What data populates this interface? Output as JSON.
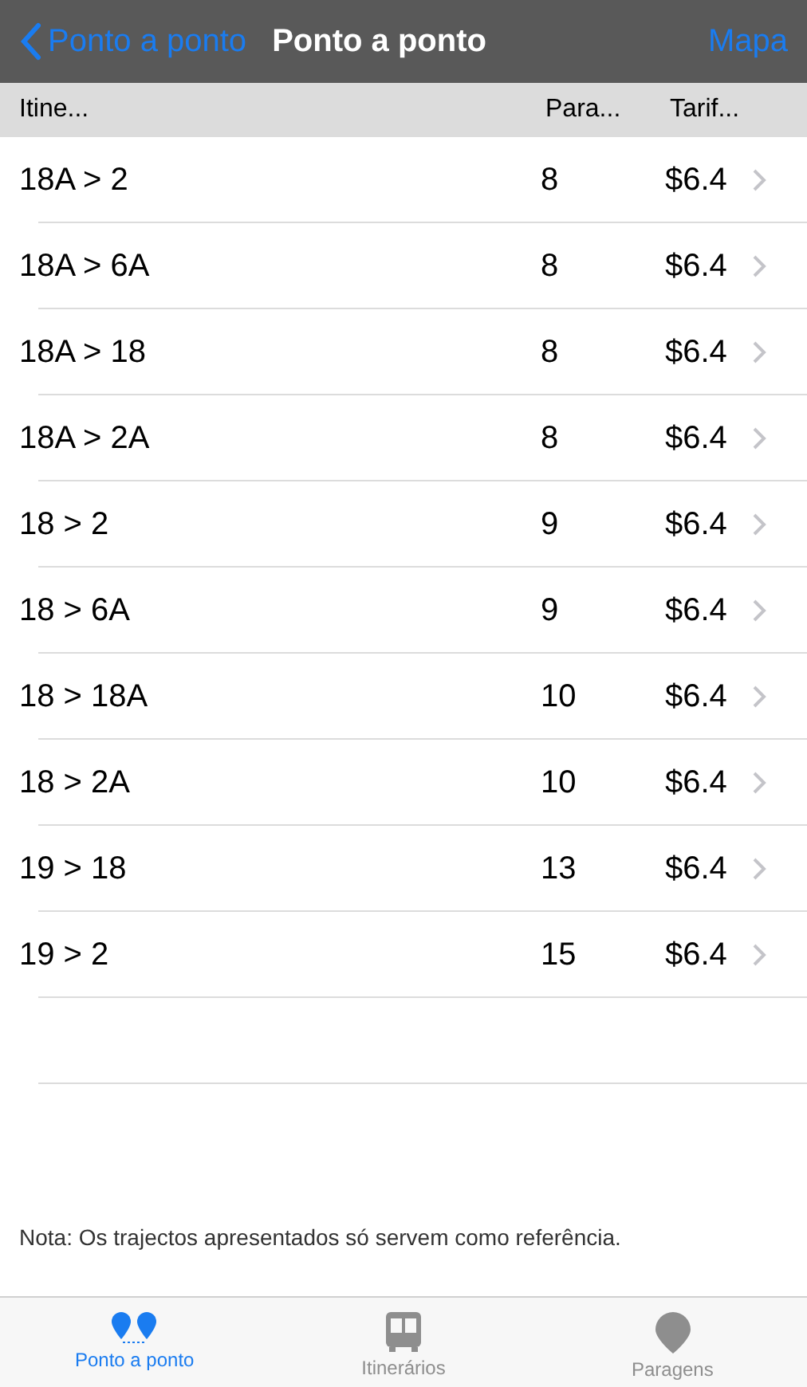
{
  "nav_bar": {
    "back": "Ponto a ponto",
    "title": "Ponto a ponto",
    "action": "Mapa"
  },
  "table": {
    "columns": [
      "Itine...",
      "Para...",
      "Tarif..."
    ],
    "rows": [
      {
        "route": "18A > 2",
        "stops": "8",
        "fare": "$6.4"
      },
      {
        "route": "18A > 6A",
        "stops": "8",
        "fare": "$6.4"
      },
      {
        "route": "18A > 18",
        "stops": "8",
        "fare": "$6.4"
      },
      {
        "route": "18A > 2A",
        "stops": "8",
        "fare": "$6.4"
      },
      {
        "route": "18 > 2",
        "stops": "9",
        "fare": "$6.4"
      },
      {
        "route": "18 > 6A",
        "stops": "9",
        "fare": "$6.4"
      },
      {
        "route": "18 > 18A",
        "stops": "10",
        "fare": "$6.4"
      },
      {
        "route": "18 > 2A",
        "stops": "10",
        "fare": "$6.4"
      },
      {
        "route": "19 > 18",
        "stops": "13",
        "fare": "$6.4"
      },
      {
        "route": "19 > 2",
        "stops": "15",
        "fare": "$6.4"
      }
    ]
  },
  "note": "Nota: Os trajectos apresentados só servem como referência.",
  "tab_bar": [
    {
      "kind": "pins",
      "label": "Ponto a ponto",
      "selected": true
    },
    {
      "kind": "bus",
      "label": "Itinerários",
      "selected": false
    },
    {
      "kind": "pin",
      "label": "Paragens",
      "selected": false
    }
  ]
}
